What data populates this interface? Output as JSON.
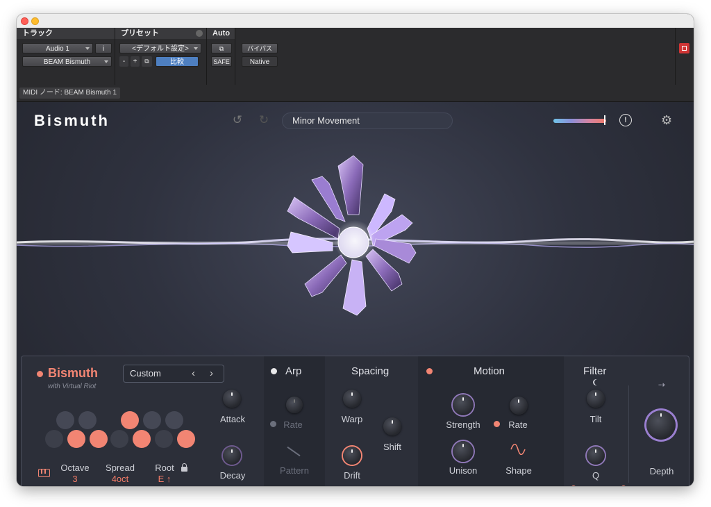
{
  "host": {
    "track_header": "トラック",
    "preset_header": "プリセット",
    "auto_header": "Auto",
    "track_name": "Audio 1",
    "info_label": "i",
    "plugin_name": "BEAM Bismuth",
    "preset_value": "<デフォルト設定>",
    "minus_label": "-",
    "plus_label": "+",
    "compare_label": "比較",
    "safe_label": "SAFE",
    "bypass_label": "バイパス",
    "native_label": "Native",
    "midi_node": "MIDI ノード: BEAM Bismuth 1"
  },
  "plugin": {
    "logo": "Bismuth",
    "preset_name": "Minor Movement",
    "warning_glyph": "!"
  },
  "panel": {
    "title": "Bismuth",
    "subtitle": "with Virtual Riot",
    "mode": "Custom",
    "attack": "Attack",
    "decay": "Decay",
    "octave_label": "Octave",
    "octave_value": "3",
    "spread_label": "Spread",
    "spread_value": "4oct",
    "root_label": "Root",
    "root_value": "E ↑",
    "arp_title": "Arp",
    "arp_rate": "Rate",
    "arp_pattern": "Pattern",
    "spacing_title": "Spacing",
    "warp": "Warp",
    "shift": "Shift",
    "drift": "Drift",
    "motion_title": "Motion",
    "strength": "Strength",
    "motion_rate": "Rate",
    "unison": "Unison",
    "shape": "Shape",
    "filter_title": "Filter",
    "tilt": "Tilt",
    "q": "Q",
    "depth": "Depth"
  },
  "colors": {
    "accent": "#f28573",
    "background": "#2c2f39"
  }
}
